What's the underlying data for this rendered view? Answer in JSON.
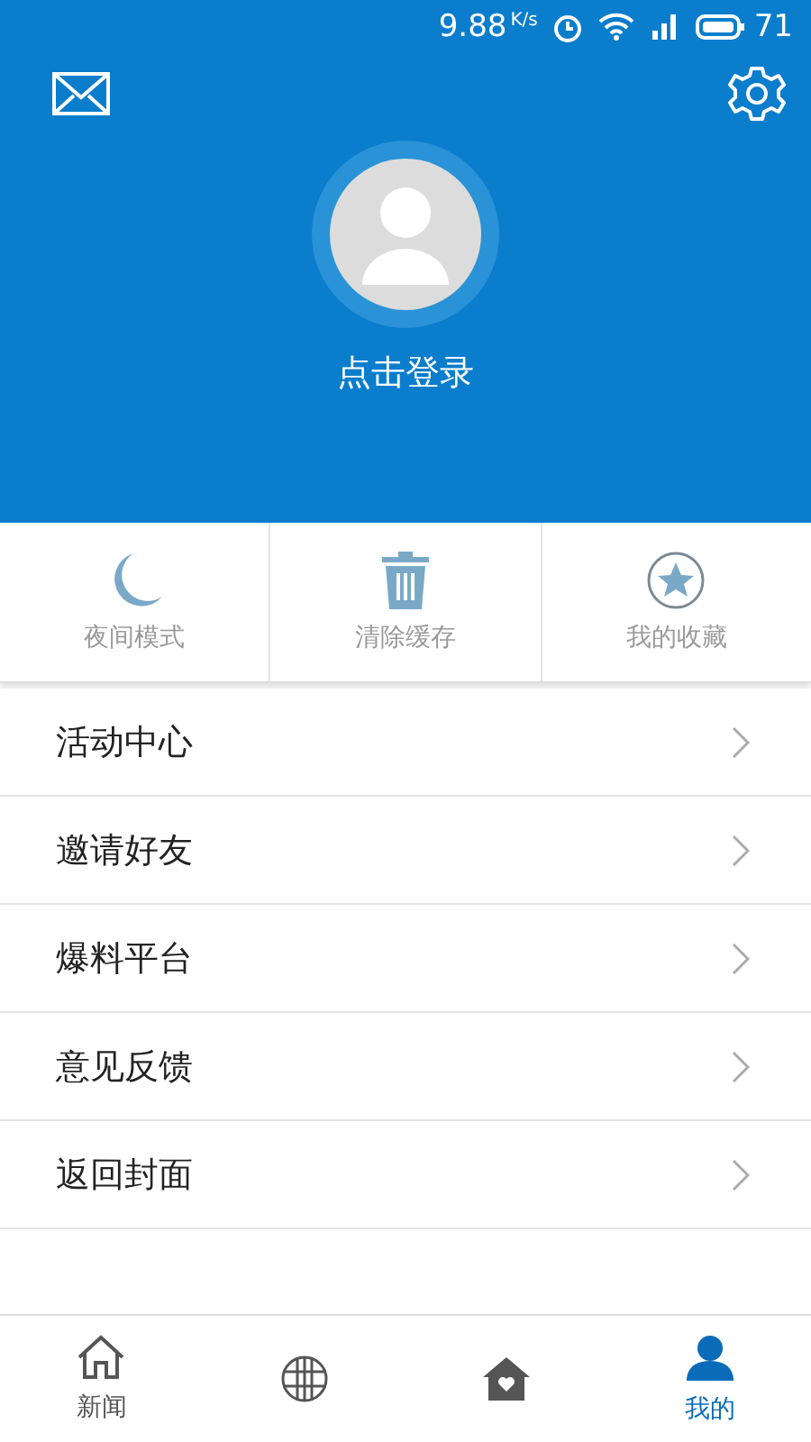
{
  "status_bar": {
    "speed": "9.88",
    "speed_unit": "K/s",
    "battery": "71"
  },
  "header": {
    "login_label": "点击登录"
  },
  "quick_actions": [
    {
      "kind": "moon",
      "label": "夜间模式"
    },
    {
      "kind": "trash",
      "label": "清除缓存"
    },
    {
      "kind": "star",
      "label": "我的收藏"
    }
  ],
  "menu": [
    {
      "label": "活动中心"
    },
    {
      "label": "邀请好友"
    },
    {
      "label": "爆料平台"
    },
    {
      "label": "意见反馈"
    },
    {
      "label": "返回封面"
    }
  ],
  "tabs": [
    {
      "kind": "home",
      "label": "新闻",
      "selected": false
    },
    {
      "kind": "globe",
      "selected": false
    },
    {
      "kind": "house",
      "selected": false
    },
    {
      "kind": "person",
      "label": "我的",
      "selected": true
    }
  ]
}
